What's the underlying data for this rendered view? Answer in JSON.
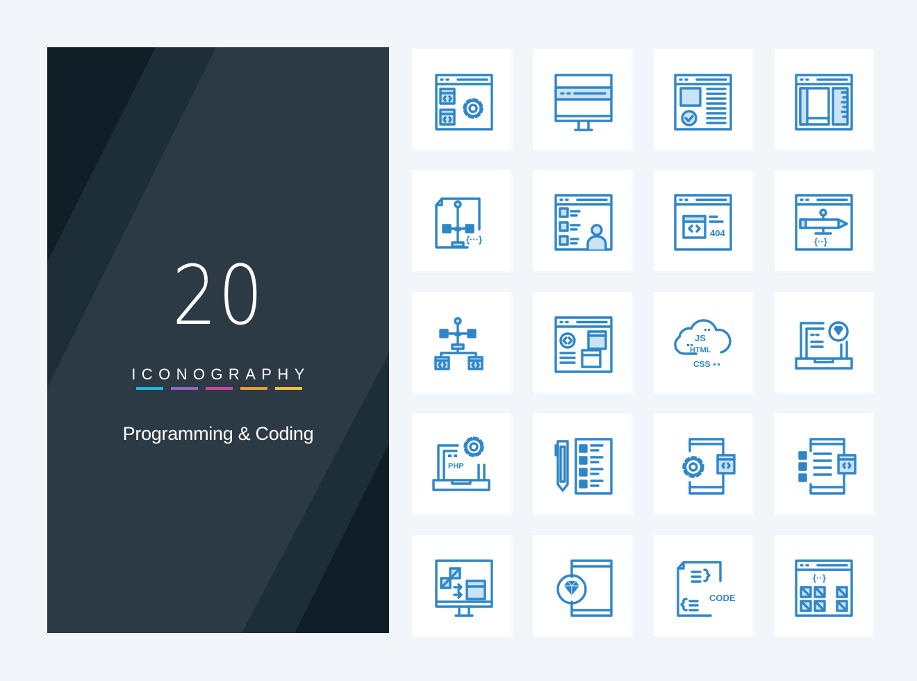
{
  "cover": {
    "count": "20",
    "subtitle": "ICONOGRAPHY",
    "title": "Programming & Coding",
    "accent_colors": [
      "#22b8de",
      "#8a6bbf",
      "#c8489b",
      "#ef9a3a",
      "#f3c13a"
    ]
  },
  "colors": {
    "icon_stroke": "#2e86c7",
    "icon_fill": "#c9e2f6",
    "panel_bg": "#2c3a46",
    "page_bg": "#f2f6fb"
  },
  "icons": [
    {
      "name": "browser-settings-icon"
    },
    {
      "name": "monitor-icon"
    },
    {
      "name": "web-page-check-icon"
    },
    {
      "name": "web-layout-icon"
    },
    {
      "name": "code-file-structure-icon"
    },
    {
      "name": "web-user-list-icon"
    },
    {
      "name": "error-404-page-icon",
      "text": "404"
    },
    {
      "name": "web-design-pen-icon"
    },
    {
      "name": "hierarchy-structure-icon"
    },
    {
      "name": "web-code-layout-icon"
    },
    {
      "name": "cloud-languages-icon",
      "text": [
        "JS",
        "HTML",
        "CSS"
      ]
    },
    {
      "name": "laptop-ruby-icon"
    },
    {
      "name": "laptop-php-settings-icon",
      "text": "PHP"
    },
    {
      "name": "pen-checklist-icon"
    },
    {
      "name": "mobile-settings-code-icon"
    },
    {
      "name": "mobile-list-code-icon"
    },
    {
      "name": "monitor-transfer-icon"
    },
    {
      "name": "mobile-ruby-icon"
    },
    {
      "name": "code-file-icon",
      "text": "CODE"
    },
    {
      "name": "web-grid-code-icon"
    }
  ]
}
